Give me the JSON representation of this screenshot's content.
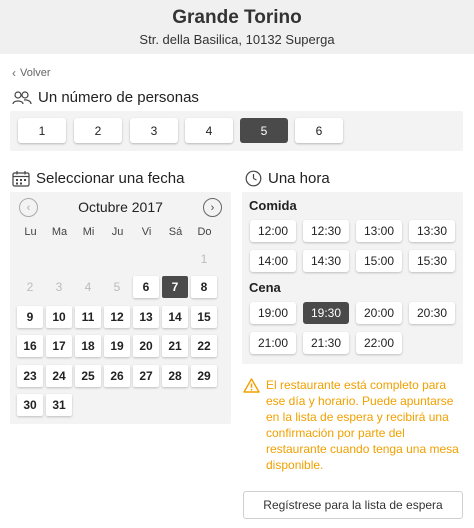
{
  "header": {
    "title": "Grande Torino",
    "address": "Str. della Basilica, 10132 Superga"
  },
  "back_label": "Volver",
  "party": {
    "title": "Un número de personas",
    "options": [
      "1",
      "2",
      "3",
      "4",
      "5",
      "6"
    ],
    "selected": "5"
  },
  "calendar": {
    "title": "Seleccionar una fecha",
    "month": "Octubre 2017",
    "weekdays": [
      "Lu",
      "Ma",
      "Mi",
      "Ju",
      "Vi",
      "Sá",
      "Do"
    ],
    "rows": [
      [
        {
          "d": "",
          "s": "blank"
        },
        {
          "d": "",
          "s": "blank"
        },
        {
          "d": "",
          "s": "blank"
        },
        {
          "d": "",
          "s": "blank"
        },
        {
          "d": "",
          "s": "blank"
        },
        {
          "d": "",
          "s": "blank"
        },
        {
          "d": "1",
          "s": "off"
        }
      ],
      [
        {
          "d": "2",
          "s": "off"
        },
        {
          "d": "3",
          "s": "off"
        },
        {
          "d": "4",
          "s": "off"
        },
        {
          "d": "5",
          "s": "off"
        },
        {
          "d": "6",
          "s": "on"
        },
        {
          "d": "7",
          "s": "sel"
        },
        {
          "d": "8",
          "s": "on"
        }
      ],
      [
        {
          "d": "9",
          "s": "on"
        },
        {
          "d": "10",
          "s": "on"
        },
        {
          "d": "11",
          "s": "on"
        },
        {
          "d": "12",
          "s": "on"
        },
        {
          "d": "13",
          "s": "on"
        },
        {
          "d": "14",
          "s": "on"
        },
        {
          "d": "15",
          "s": "on"
        }
      ],
      [
        {
          "d": "16",
          "s": "on"
        },
        {
          "d": "17",
          "s": "on"
        },
        {
          "d": "18",
          "s": "on"
        },
        {
          "d": "19",
          "s": "on"
        },
        {
          "d": "20",
          "s": "on"
        },
        {
          "d": "21",
          "s": "on"
        },
        {
          "d": "22",
          "s": "on"
        }
      ],
      [
        {
          "d": "23",
          "s": "on"
        },
        {
          "d": "24",
          "s": "on"
        },
        {
          "d": "25",
          "s": "on"
        },
        {
          "d": "26",
          "s": "on"
        },
        {
          "d": "27",
          "s": "on"
        },
        {
          "d": "28",
          "s": "on"
        },
        {
          "d": "29",
          "s": "on"
        }
      ],
      [
        {
          "d": "30",
          "s": "on"
        },
        {
          "d": "31",
          "s": "on"
        },
        {
          "d": "",
          "s": "blank"
        },
        {
          "d": "",
          "s": "blank"
        },
        {
          "d": "",
          "s": "blank"
        },
        {
          "d": "",
          "s": "blank"
        },
        {
          "d": "",
          "s": "blank"
        }
      ]
    ]
  },
  "time": {
    "title": "Una hora",
    "lunch_label": "Comida",
    "lunch": [
      "12:00",
      "12:30",
      "13:00",
      "13:30",
      "14:00",
      "14:30",
      "15:00",
      "15:30"
    ],
    "dinner_label": "Cena",
    "dinner": [
      "19:00",
      "19:30",
      "20:00",
      "20:30",
      "21:00",
      "21:30",
      "22:00"
    ],
    "selected": "19:30"
  },
  "warning": "El restaurante está completo para ese día y horario. Puede apuntarse en la lista de espera y recibirá una confirmación por parte del restaurante cuando tenga una mesa disponible.",
  "waitlist_button": "Regístrese para la lista de espera",
  "colors": {
    "selected": "#4a4a4a",
    "warning": "#f0a000",
    "panel": "#f3f3f3"
  }
}
